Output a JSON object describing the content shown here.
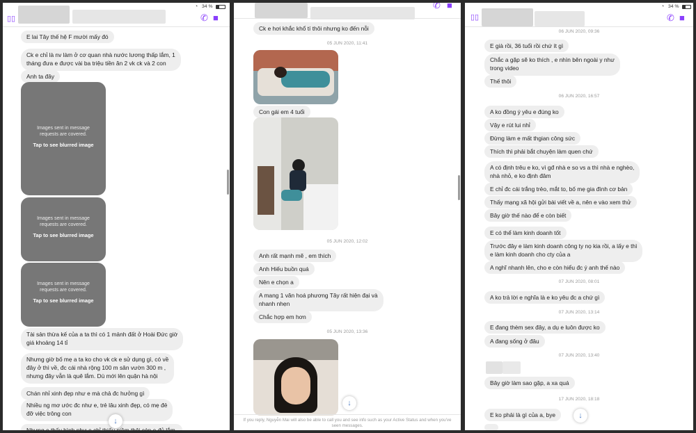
{
  "status": {
    "battery": "34 %"
  },
  "panel1": {
    "messages": [
      "E lai Tây thế hệ F mười mấy đó",
      "Ck e chỉ là nv làm ở cơ quan nhà nước lương thấp lắm, 1",
      "tháng đưa e được vài ba triệu tiền ăn 2 vk ck và 2 con",
      "Anh ta đây",
      "Tài sản thừa kế của a ta thì có 1 mảnh đất ở Hoài Đức giờ",
      "giá khoảng 14 tỉ",
      "Nhưng giờ bố mẹ a ta ko cho vk ck e sử dụng gì, có về",
      "đây ở thì về, đc cái nhà rộng 100 m sân vườn 300 m ,",
      "nhưng đây vẫn là quê lắm. Dù mới lên quận hà nội",
      "Chán nhỉ xinh đẹp như e mà chả đc hưởng gì",
      "Nhiều ng mơ ước đc như e, trẻ lâu xinh đẹp, có mẹ đẻ",
      "đỡ việc trông con",
      "Nhưng e thấy hình như e chỉ thiếu niềm thôi còn e đủ lắm."
    ],
    "blur_notice_1": "Images sent in message",
    "blur_notice_2": "requests are covered.",
    "blur_tap": "Tap to see blurred image"
  },
  "panel2": {
    "top_msg": "Ck e hơi khắc khổ tí thôi nhưng ko đến nỗi",
    "ts1": "05 JUN 2020, 11:41",
    "msg_daughter": "Con gái em 4 tuổi",
    "ts2": "05 JUN 2020, 12:02",
    "msgs": [
      "Anh rất mạnh mẽ , em thích",
      "Anh Hiếu buồn quá",
      "Nên e chọn a",
      "A mang 1 văn hoá phương Tây rất hiện đại và",
      "nhanh nhẹn",
      "Chắc hợp em hơn"
    ],
    "ts3": "05 JUN 2020, 13:36",
    "footer": "If you reply, Nguyễn Mai will also be able to call you and see info such as your Active Status and when you've seen messages."
  },
  "panel3": {
    "ts1": "06 JUN 2020, 09:36",
    "a": [
      "E già rồi, 36 tuổi rồi chứ ít gì",
      "Chắc a gặp sẽ ko thích , e nhìn bên ngoài y như",
      "trong video",
      "Thế thôi"
    ],
    "ts2": "06 JUN 2020, 16:57",
    "b": [
      "A ko đồng ý yêu e đúng ko",
      "Vậy e rút lui nhỉ",
      "Đừng làm e mất thgian công sức",
      "Thích thì phải bắt chuyện làm quen chứ",
      "A có định trêu e ko, vì gđ nhà e so vs a thì nhà e nghèo,",
      "nhà nhỏ, e ko định đâm",
      "E chỉ đc cái trắng trẻo, mắt to, bố mẹ gia đình cơ bản",
      "Thấy mạng xã hội gửi bài viết về a, nên e vào xem thử",
      "Bây giờ thế nào để e còn biết",
      "E có thể làm kinh doanh tốt",
      "Trước đây e làm kinh doanh  công ty nọ kia rồi, a lấy e thì",
      "e làm kinh doanh cho cty của a",
      "A nghĩ nhanh lên, cho e còn hiểu đc ý anh thế nào"
    ],
    "ts3": "07 JUN 2020, 08:01",
    "c": "A ko trả lời e nghĩa là e ko yêu đc a chứ gì",
    "ts4": "07 JUN 2020, 13:14",
    "d": [
      "E đang thèm sex đây, a dụ e luôn được ko",
      "A đang sống ở đâu"
    ],
    "ts5": "07 JUN 2020, 13:40",
    "e": "Bây giờ làm sao gặp, a xa quá",
    "ts6": "17 JUN 2020, 18:18",
    "f": "E ko phải là gì của a, bye"
  },
  "colors": {
    "accent": "#8a3ffc",
    "bubble": "#eeeeee",
    "blur": "#777777"
  },
  "icons": [
    "sidebar-icon",
    "phone-icon",
    "video-icon",
    "down-arrow-icon",
    "wifi-icon",
    "battery-icon"
  ]
}
